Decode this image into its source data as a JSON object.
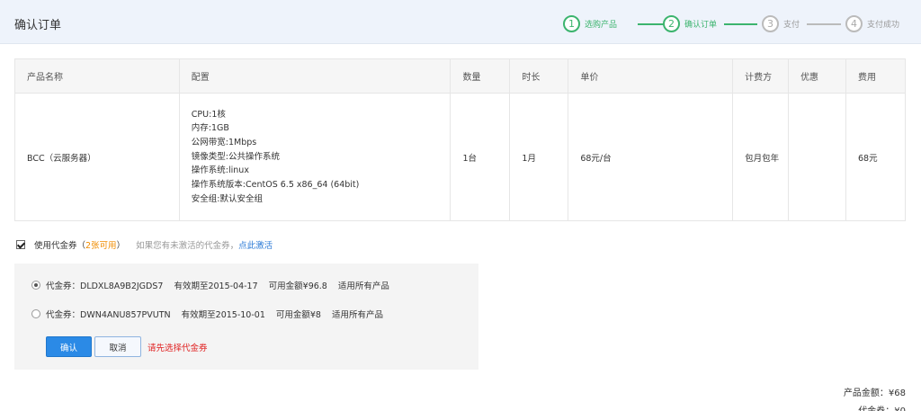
{
  "header": {
    "title": "确认订单",
    "steps": [
      {
        "num": "1",
        "label": "选购产品",
        "state": "done"
      },
      {
        "num": "2",
        "label": "确认订单",
        "state": "done"
      },
      {
        "num": "3",
        "label": "支付",
        "state": "todo"
      },
      {
        "num": "4",
        "label": "支付成功",
        "state": "todo"
      }
    ]
  },
  "table": {
    "headers": [
      "产品名称",
      "配置",
      "数量",
      "时长",
      "单价",
      "计费方",
      "优惠",
      "费用"
    ],
    "row": {
      "product": "BCC（云服务器）",
      "config": [
        "CPU:1核",
        "内存:1GB",
        "公网带宽:1Mbps",
        "镜像类型:公共操作系统",
        "操作系统:linux",
        "操作系统版本:CentOS 6.5 x86_64 (64bit)",
        "安全组:默认安全组"
      ],
      "quantity": "1台",
      "duration": "1月",
      "unit_price": "68元/台",
      "billing": "包月包年",
      "discount": "",
      "cost": "68元"
    }
  },
  "voucher": {
    "use_label_prefix": "使用代金券（",
    "count": "2张可用",
    "use_label_suffix": "）",
    "hint": "如果您有未激活的代金券，",
    "activate_link": "点此激活",
    "checked": true,
    "items": [
      {
        "code": "代金券：DLDXL8A9B2JGDS7",
        "expiry": "有效期至2015-04-17",
        "amount": "可用金额¥96.8",
        "scope": "适用所有产品",
        "selected": true
      },
      {
        "code": "代金券：DWN4ANU857PVUTN",
        "expiry": "有效期至2015-10-01",
        "amount": "可用金额¥8",
        "scope": "适用所有产品",
        "selected": false
      }
    ],
    "confirm_label": "确认",
    "cancel_label": "取消",
    "error": "请先选择代金券"
  },
  "summary": {
    "product_amount": "产品金额：¥68",
    "voucher_amount": "代金券：¥0"
  },
  "colors": {
    "accent_green": "#3cb46e",
    "primary_blue": "#2b8ae6",
    "link_blue": "#2b7ad6",
    "error_red": "#e02020",
    "count_orange": "#f08c00"
  }
}
